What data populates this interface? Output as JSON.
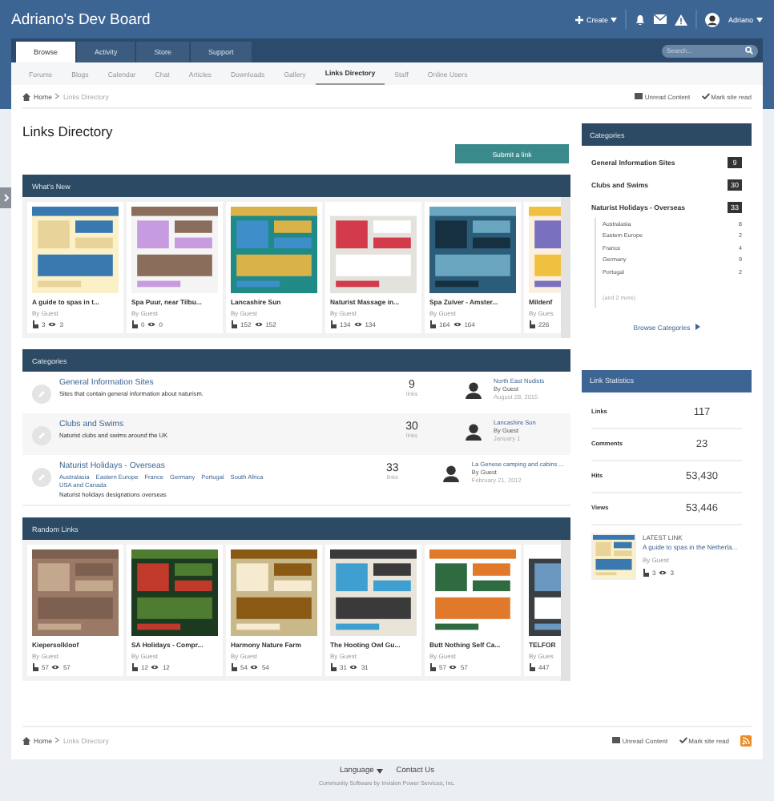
{
  "header": {
    "site_title": "Adriano's Dev Board",
    "create": "Create",
    "user": "Adriano"
  },
  "tabs": [
    {
      "label": "Browse",
      "selected": true
    },
    {
      "label": "Activity",
      "selected": false
    },
    {
      "label": "Store",
      "selected": false
    },
    {
      "label": "Support",
      "selected": false
    }
  ],
  "search": {
    "placeholder": "Search..."
  },
  "subnav": [
    {
      "label": "Forums",
      "selected": false
    },
    {
      "label": "Blogs",
      "selected": false
    },
    {
      "label": "Calendar",
      "selected": false
    },
    {
      "label": "Chat",
      "selected": false
    },
    {
      "label": "Articles",
      "selected": false
    },
    {
      "label": "Downloads",
      "selected": false
    },
    {
      "label": "Gallery",
      "selected": false
    },
    {
      "label": "Links Directory",
      "selected": true
    },
    {
      "label": "Staff",
      "selected": false
    },
    {
      "label": "Online Users",
      "selected": false
    }
  ],
  "breadcrumb": [
    "Home",
    "Links Directory"
  ],
  "top_actions": [
    "Unread Content",
    "Mark site read"
  ],
  "page_title": "Links Directory",
  "submit_button": "Submit a link",
  "whats_new": {
    "title": "What's New",
    "items": [
      {
        "title": "A guide to spas in t...",
        "author": "By Guest",
        "clicks": "3",
        "views": "3"
      },
      {
        "title": "Spa Puur, near Tilbu...",
        "author": "By Guest",
        "clicks": "0",
        "views": "0"
      },
      {
        "title": "Lancashire Sun",
        "author": "By Guest",
        "clicks": "152",
        "views": "152"
      },
      {
        "title": "Naturist Massage in...",
        "author": "By Guest",
        "clicks": "134",
        "views": "134"
      },
      {
        "title": "Spa Zuiver - Amster...",
        "author": "By Guest",
        "clicks": "164",
        "views": "164"
      },
      {
        "title": "Mildenf",
        "author": "By Gues",
        "clicks": "226"
      }
    ]
  },
  "categories": {
    "title": "Categories",
    "rows": [
      {
        "name": "General Information Sites",
        "description": "Sites that contain general information about naturism.",
        "count": "9",
        "count_label": "links",
        "last_title": "North East Nudists",
        "last_author": "By Guest",
        "last_date": "August 28, 2015"
      },
      {
        "name": "Clubs and Swims",
        "description": "Naturist clubs and swims around the UK",
        "count": "30",
        "count_label": "links",
        "last_title": "Lancashire Sun",
        "last_author": "By Guest",
        "last_date": "January 1"
      },
      {
        "name": "Naturist Holidays - Overseas",
        "subcategories": [
          "Australasia",
          "Eastern Europe",
          "France",
          "Germany",
          "Portugal",
          "South Africa",
          "USA and Canada"
        ],
        "description": "Naturist holidays designations overseas",
        "count": "33",
        "count_label": "links",
        "last_title": "La Genese camping and cabins ...",
        "last_author": "By Guest",
        "last_date": "February 21, 2012"
      }
    ]
  },
  "random_links": {
    "title": "Random Links",
    "items": [
      {
        "title": "Kiepersolkloof",
        "author": "By Guest",
        "clicks": "57",
        "views": "57"
      },
      {
        "title": "SA Holidays - Compr...",
        "author": "By Guest",
        "clicks": "12",
        "views": "12"
      },
      {
        "title": "Harmony Nature Farm",
        "author": "By Guest",
        "clicks": "54",
        "views": "54"
      },
      {
        "title": "The Hooting Owl Gu...",
        "author": "By Guest",
        "clicks": "31",
        "views": "31"
      },
      {
        "title": "Butt Nothing Self Ca...",
        "author": "By Guest",
        "clicks": "57",
        "views": "57"
      },
      {
        "title": "TELFOR",
        "author": "By Gues",
        "clicks": "447"
      }
    ]
  },
  "sidebar_categories": {
    "title": "Categories",
    "items": [
      {
        "name": "General Information Sites",
        "count": "9"
      },
      {
        "name": "Clubs and Swims",
        "count": "30"
      },
      {
        "name": "Naturist Holidays - Overseas",
        "count": "33",
        "children": [
          {
            "name": "Australasia",
            "count": "8"
          },
          {
            "name": "Eastern Europe",
            "count": "2"
          },
          {
            "name": "France",
            "count": "4"
          },
          {
            "name": "Germany",
            "count": "9"
          },
          {
            "name": "Portugal",
            "count": "2"
          }
        ],
        "more": "(and 2 more)"
      }
    ],
    "browse": "Browse Categories"
  },
  "link_statistics": {
    "title": "Link Statistics",
    "rows": [
      {
        "label": "Links",
        "value": "117"
      },
      {
        "label": "Comments",
        "value": "23"
      },
      {
        "label": "Hits",
        "value": "53,430"
      },
      {
        "label": "Views",
        "value": "53,446"
      }
    ]
  },
  "latest_link": {
    "label": "LATEST LINK",
    "title": "A guide to spas in the Netherla...",
    "author": "By Guest",
    "clicks": "3",
    "views": "3"
  },
  "footer_breadcrumb": [
    "Home",
    "Links Directory"
  ],
  "footer_actions": [
    "Unread Content",
    "Mark site read"
  ],
  "footer_links": [
    "Language",
    "Contact Us"
  ],
  "copyright": "Community Software by Invision Power Services, Inc."
}
